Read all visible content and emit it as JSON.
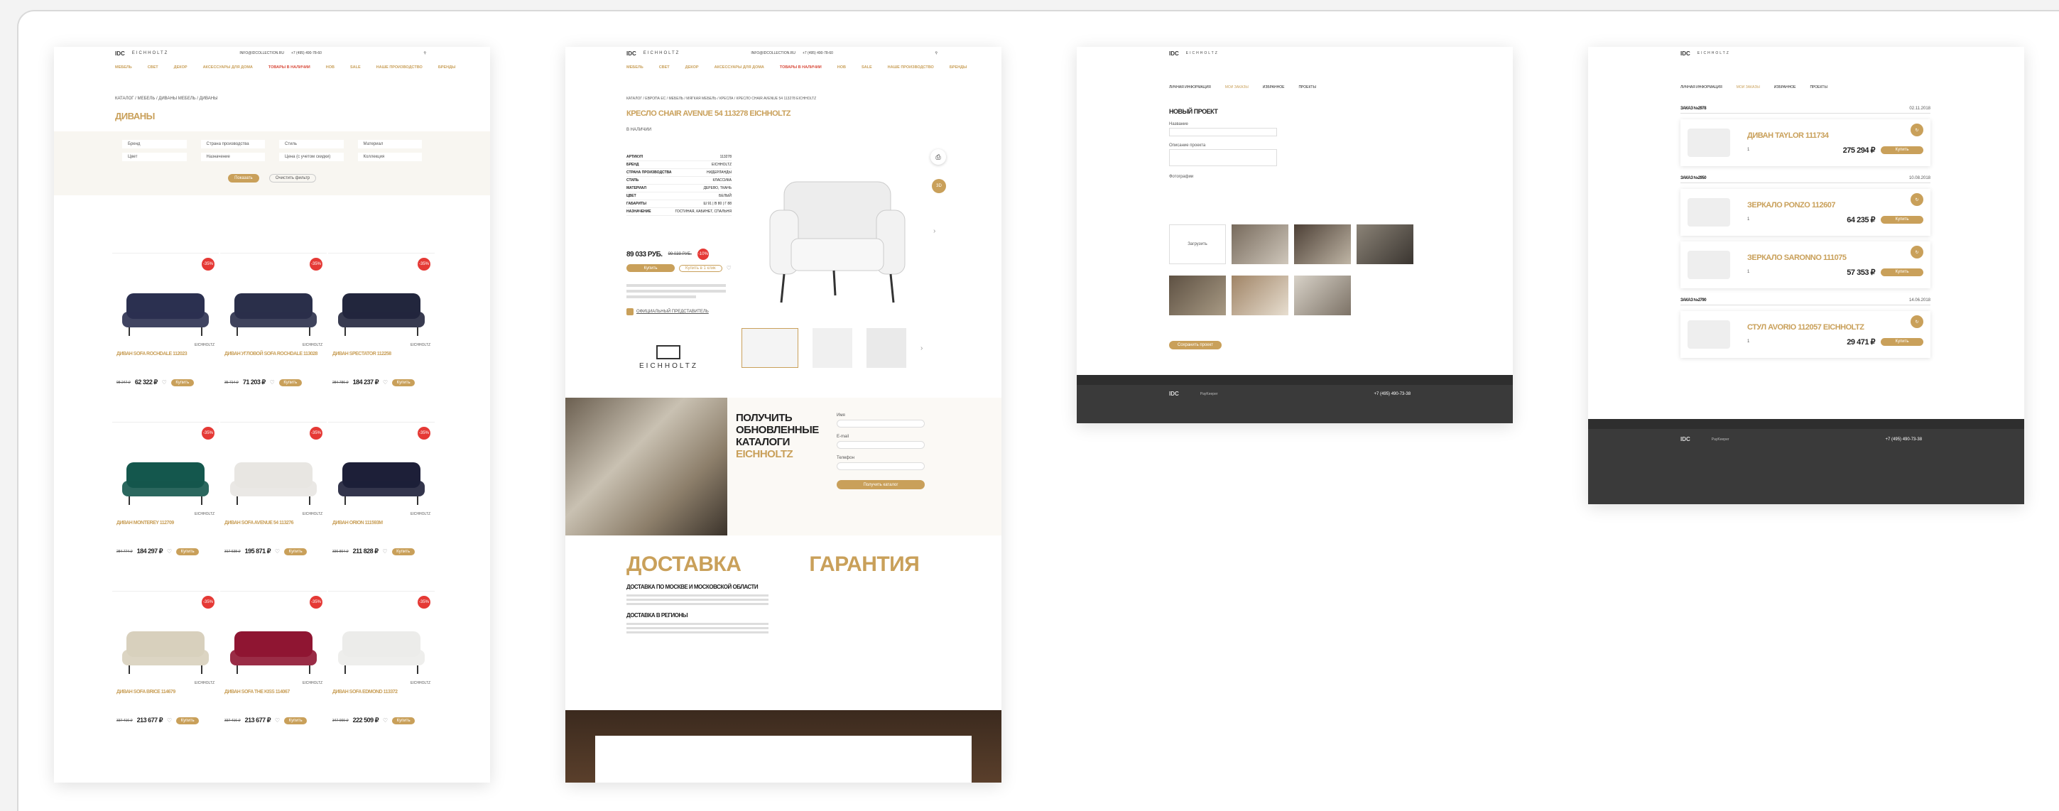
{
  "brand": {
    "logo": "IDC",
    "partner": "EICHHOLTZ",
    "phone": "+7 (495) 490-78-60",
    "email": "INFO@IDCOLLECTION.RU"
  },
  "nav": [
    "МЕБЕЛЬ",
    "СВЕТ",
    "ДЕКОР",
    "АКСЕССУАРЫ ДЛЯ ДОМА",
    "ТОВАРЫ В НАЛИЧИИ",
    "НОВ",
    "SALE",
    "НАШЕ ПРОИЗВОДСТВО",
    "БРЕНДЫ"
  ],
  "catalog": {
    "breadcrumb": "КАТАЛОГ / МЕБЕЛЬ / ДИВАНЫ МЕБЕЛЬ / ДИВАНЫ",
    "title": "ДИВАНЫ",
    "filters": [
      "Бренд",
      "Страна производства",
      "Стиль",
      "Материал",
      "Цвет",
      "Назначение",
      "Цена (с учетом скидки)",
      "Коллекция"
    ],
    "apply": "Показать",
    "reset": "Очистить фильтр",
    "products": [
      {
        "name": "ДИВАН SOFA ROCHDALE 112023",
        "old": "98 247 ₽",
        "price": "62 322 ₽",
        "sale": "-35%",
        "color": "#2b3050"
      },
      {
        "name": "ДИВАН УГЛОВОЙ SOFA ROCHDALE 113028",
        "old": "35 714 ₽",
        "price": "71 203 ₽",
        "sale": "-35%",
        "color": "#2a2f4a"
      },
      {
        "name": "ДИВАН SPECTATOR 112258",
        "old": "284 786 ₽",
        "price": "184 237 ₽",
        "sale": "-35%",
        "color": "#22263d"
      },
      {
        "name": "ДИВАН MONTEREY 112709",
        "old": "284 774 ₽",
        "price": "184 297 ₽",
        "sale": "-35%",
        "color": "#14574d"
      },
      {
        "name": "ДИВАН SOFA AVENUE 54 113276",
        "old": "317 638 ₽",
        "price": "195 871 ₽",
        "sale": "-35%",
        "color": "#e8e6e2"
      },
      {
        "name": "ДИВАН ORION 111593M",
        "old": "336 864 ₽",
        "price": "211 828 ₽",
        "sale": "-35%",
        "color": "#1d1f38"
      },
      {
        "name": "ДИВАН SOFA BRICE 114679",
        "old": "337 416 ₽",
        "price": "213 677 ₽",
        "sale": "-35%",
        "color": "#d8d0bd"
      },
      {
        "name": "ДИВАН SOFA THE KISS 114067",
        "old": "337 416 ₽",
        "price": "213 677 ₽",
        "sale": "-35%",
        "color": "#8f1532"
      },
      {
        "name": "ДИВАН SOFA EDMOND 113372",
        "old": "347 000 ₽",
        "price": "222 509 ₽",
        "sale": "-35%",
        "color": "#ececea"
      }
    ],
    "buy": "Купить",
    "brand_tag": "EICHHOLTZ"
  },
  "product": {
    "breadcrumb": "КАТАЛОГ / ЕВРОПА ЕС / МЕБЕЛЬ / МЯГКАЯ МЕБЕЛЬ / КРЕСЛА / КРЕСЛО CHAIR AVENUE 54 113278 EICHHOLTZ",
    "title": "КРЕСЛО CHAIR AVENUE 54 113278 EICHHOLTZ",
    "stock": "В НАЛИЧИИ",
    "specs": [
      [
        "АРТИКУЛ",
        "113278"
      ],
      [
        "БРЕНД",
        "EICHHOLTZ"
      ],
      [
        "СТРАНА ПРОИЗВОДСТВА",
        "НИДЕРЛАНДЫ"
      ],
      [
        "СТИЛЬ",
        "КЛАССИКА"
      ],
      [
        "МАТЕРИАЛ",
        "ДЕРЕВО, ТКАНЬ"
      ],
      [
        "ЦВЕТ",
        "БЕЛЫЙ"
      ],
      [
        "ГАБАРИТЫ",
        "Ш 91 | В 80 | Г 88"
      ],
      [
        "НАЗНАЧЕНИЕ",
        "ГОСТИНАЯ, КАБИНЕТ, СПАЛЬНЯ"
      ]
    ],
    "price": "89 033 РУБ.",
    "old": "99 039 РУБ.",
    "sale": "-10%",
    "buy": "Купить",
    "oneclick": "Купить в 1 клик",
    "official": "ОФИЦИАЛЬНЫЙ ПРЕДСТАВИТЕЛЬ",
    "badge": "3D",
    "logo": "EICHHOLTZ",
    "promo_title1": "ПОЛУЧИТЬ",
    "promo_title2": "ОБНОВЛЕННЫЕ",
    "promo_title3": "КАТАЛОГИ",
    "promo_brand": "EICHHOLTZ",
    "form_name": "Имя",
    "form_email": "E-mail",
    "form_phone": "Телефон",
    "form_submit": "Получить каталог",
    "delivery": "ДОСТАВКА",
    "warranty": "ГАРАНТИЯ",
    "delivery_moscow": "ДОСТАВКА ПО МОСКВЕ И МОСКОВСКОЙ ОБЛАСТИ",
    "delivery_regions": "ДОСТАВКА В РЕГИОНЫ"
  },
  "project": {
    "tabs": [
      "ЛИЧНАЯ ИНФОРМАЦИЯ",
      "МОИ ЗАКАЗЫ",
      "ИЗБРАННОЕ",
      "ПРОЕКТЫ"
    ],
    "title": "НОВЫЙ ПРОЕКТ",
    "name_label": "Название",
    "desc_label": "Описание проекта",
    "photos_label": "Фотографии",
    "add_photo": "Загрузить",
    "save": "Сохранить проект"
  },
  "orders": {
    "tabs": [
      "ЛИЧНАЯ ИНФОРМАЦИЯ",
      "МОИ ЗАКАЗЫ",
      "ИЗБРАННОЕ",
      "ПРОЕКТЫ"
    ],
    "groups": [
      {
        "id": "ЗАКАЗ №2978",
        "date": "02.11.2018",
        "items": [
          {
            "name": "ДИВАН TAYLOR 111734",
            "price": "275 294 ₽"
          }
        ]
      },
      {
        "id": "ЗАКАЗ №2950",
        "date": "10.08.2018",
        "items": [
          {
            "name": "ЗЕРКАЛО PONZO 112607",
            "price": "64 235 ₽"
          },
          {
            "name": "ЗЕРКАЛО SARONNO 111075",
            "price": "57 353 ₽"
          }
        ]
      },
      {
        "id": "ЗАКАЗ №2790",
        "date": "14.06.2018",
        "items": [
          {
            "name": "СТУЛ AVORIO 112057 EICHHOLTZ",
            "price": "29 471 ₽"
          }
        ]
      }
    ],
    "qty": "1",
    "repeat": "Купить"
  },
  "footer": {
    "phone": "+7 (495) 490-73-38",
    "pay": "PayKeeper"
  },
  "colors": {
    "gold": "#c9a05a",
    "sale": "#e53935",
    "footer": "#3a3a3a"
  }
}
